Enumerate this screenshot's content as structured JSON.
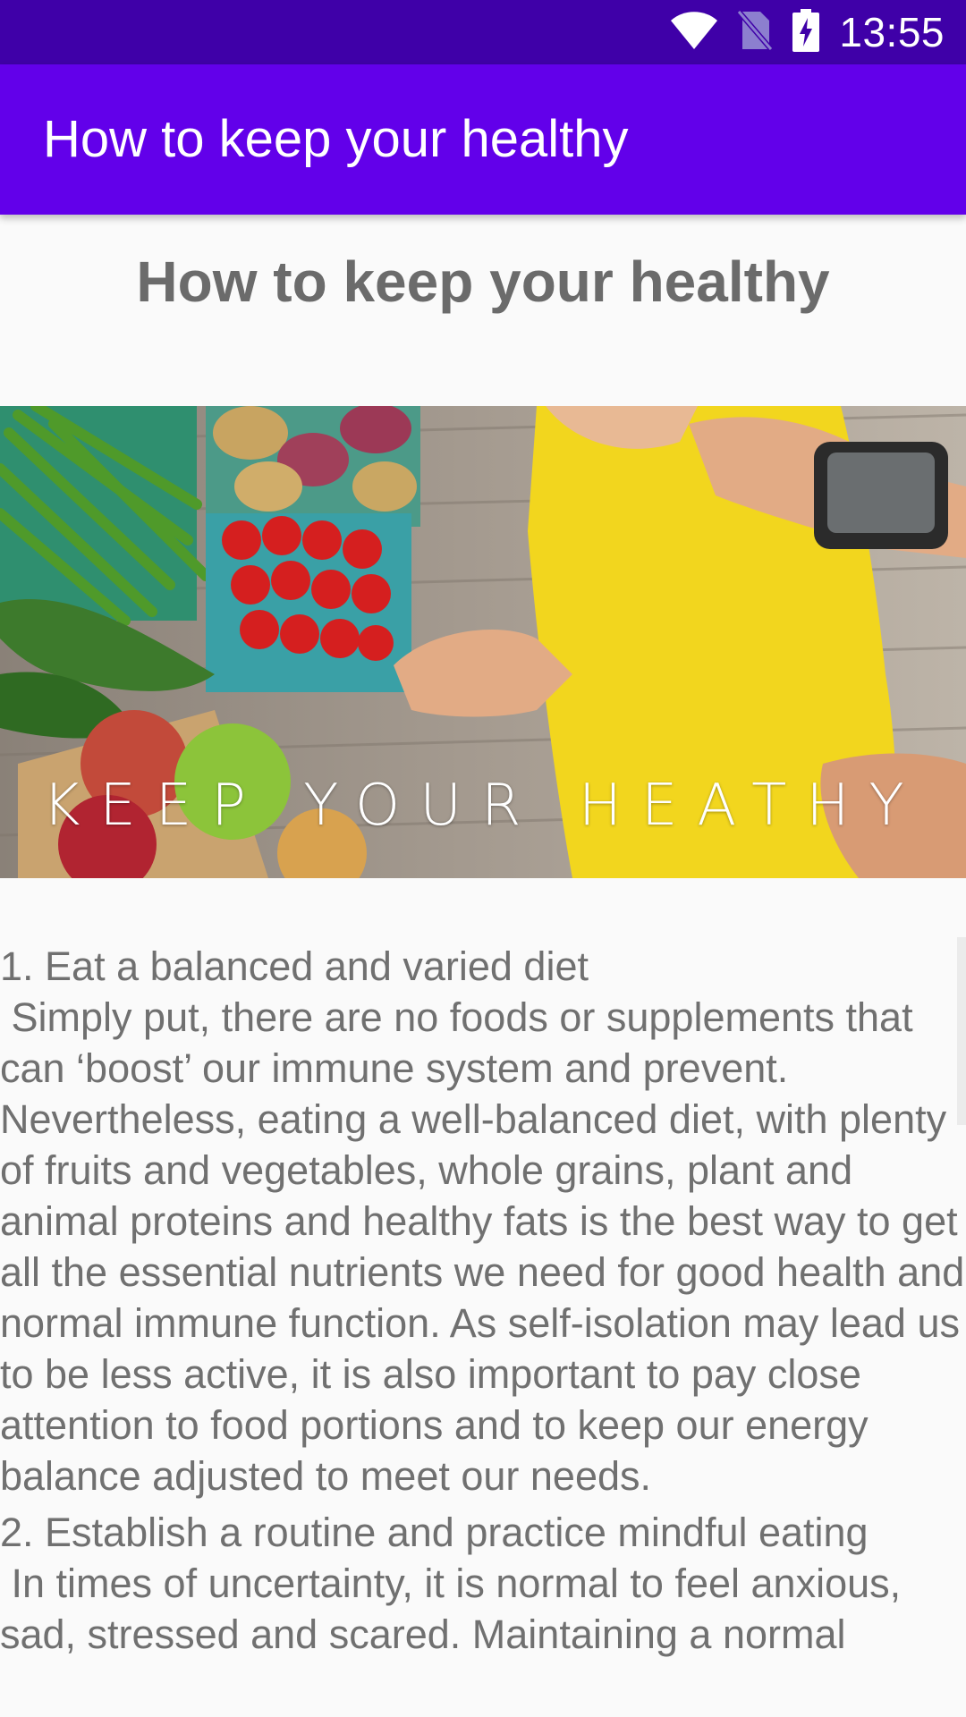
{
  "status_bar": {
    "time": "13:55",
    "icons": [
      "wifi-icon",
      "no-sim-icon",
      "battery-charging-icon"
    ]
  },
  "app_bar": {
    "title": "How to keep your healthy"
  },
  "content": {
    "heading": "How to keep your healthy",
    "hero_caption": "KEEP YOUR HEATHY",
    "paragraphs": [
      {
        "title": "1. Eat a balanced and varied diet",
        "body": " Simply put, there are no foods or supplements that can ‘boost’ our immune system and prevent. Nevertheless, eating a well-balanced diet, with plenty of fruits and vegetables, whole grains, plant and animal proteins and healthy fats is the best way to get all the essential nutrients we need for good health and normal immune function. As self-isolation may lead us to be less active, it is also important to pay close attention to food portions and to keep our energy balance adjusted to meet our needs."
      },
      {
        "title": "2. Establish a routine and practice mindful eating",
        "body": " In times of uncertainty, it is normal to feel anxious, sad, stressed and scared. Maintaining a normal"
      }
    ]
  },
  "colors": {
    "status_bar": "#3f00a8",
    "app_bar": "#6200ea",
    "text": "#707070",
    "background": "#fafafa"
  }
}
